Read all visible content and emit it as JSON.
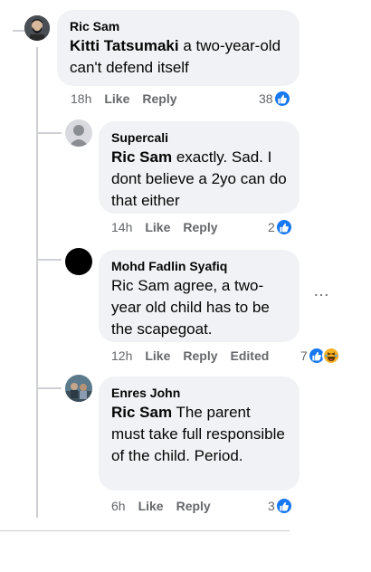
{
  "comments": [
    {
      "author": "Ric Sam",
      "mention": "Kitti Tatsumaki",
      "text": " a two-year-old can't defend itself",
      "time": "18h",
      "like_label": "Like",
      "reply_label": "Reply",
      "reaction_count": "38"
    },
    {
      "author": "Supercali",
      "mention": "Ric Sam",
      "text": " exactly. Sad. I dont believe a 2yo can do that either",
      "time": "14h",
      "like_label": "Like",
      "reply_label": "Reply",
      "reaction_count": "2"
    },
    {
      "author": "Mohd Fadlin Syafiq",
      "mention": "",
      "text": "Ric Sam agree, a two-year old child has to be the scapegoat.",
      "time": "12h",
      "like_label": "Like",
      "reply_label": "Reply",
      "edited_label": "Edited",
      "reaction_count": "7"
    },
    {
      "author": "Enres John",
      "mention": "Ric Sam",
      "text": " The parent must take full responsible of the child. Period.",
      "time": "6h",
      "like_label": "Like",
      "reply_label": "Reply",
      "reaction_count": "3"
    }
  ],
  "more_options": "…",
  "colors": {
    "like_blue": "#1877f2",
    "bubble_bg": "#f0f2f5",
    "meta_gray": "#65676b"
  },
  "icons": {
    "like": "like-icon",
    "haha": "haha-icon",
    "more": "more-options-icon"
  }
}
